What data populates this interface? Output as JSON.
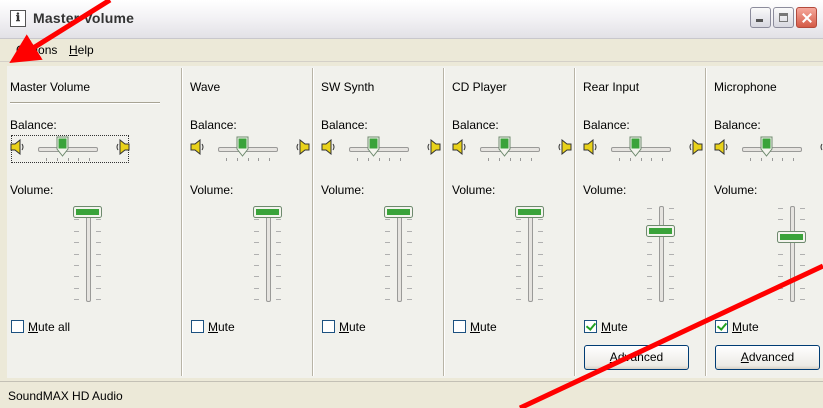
{
  "window": {
    "title": "Master Volume",
    "status": "SoundMAX HD Audio"
  },
  "menu": {
    "options": {
      "accel": "p",
      "pre": "O",
      "post": "tions"
    },
    "help": {
      "accel": "H",
      "pre": "",
      "post": "elp"
    }
  },
  "balance_label": "Balance:",
  "volume_label": "Volume:",
  "channels": [
    {
      "name": "Master Volume",
      "balance": 0.5,
      "volume": 1.0,
      "mute": {
        "accel": "M",
        "rest": "ute all"
      },
      "muted": false,
      "has_advanced": false,
      "focused": true
    },
    {
      "name": "Wave",
      "balance": 0.5,
      "volume": 1.0,
      "mute": {
        "accel": "M",
        "rest": "ute"
      },
      "muted": false,
      "has_advanced": false,
      "focused": false
    },
    {
      "name": "SW Synth",
      "balance": 0.5,
      "volume": 1.0,
      "mute": {
        "accel": "M",
        "rest": "ute"
      },
      "muted": false,
      "has_advanced": false,
      "focused": false
    },
    {
      "name": "CD Player",
      "balance": 0.5,
      "volume": 1.0,
      "mute": {
        "accel": "M",
        "rest": "ute"
      },
      "muted": false,
      "has_advanced": false,
      "focused": false
    },
    {
      "name": "Rear Input",
      "balance": 0.5,
      "volume": 0.77,
      "mute": {
        "accel": "M",
        "rest": "ute"
      },
      "muted": true,
      "has_advanced": true,
      "advanced": {
        "accel": "A",
        "rest": "dvanced"
      },
      "focused": false
    },
    {
      "name": "Microphone",
      "balance": 0.5,
      "volume": 0.7,
      "mute": {
        "accel": "M",
        "rest": "ute"
      },
      "muted": true,
      "has_advanced": true,
      "advanced": {
        "accel": "A",
        "rest": "dvanced"
      },
      "focused": false
    }
  ],
  "colors": {
    "window_bg": "#ece9d8",
    "thumb_green": "#3aa33a",
    "annotation_red": "#ff0000"
  }
}
